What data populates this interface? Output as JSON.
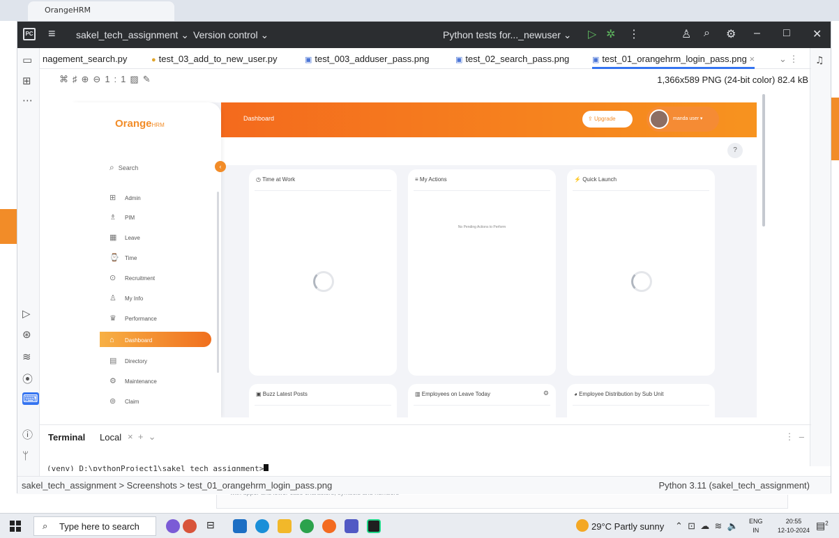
{
  "browser_tab": {
    "label": "OrangeHRM"
  },
  "titlebar": {
    "project": "sakel_tech_assignment",
    "version_control": "Version control",
    "run_config": "Python tests for..._newuser"
  },
  "editor_tabs": [
    {
      "label": "nagement_search.py"
    },
    {
      "label": "test_03_add_to_new_user.py"
    },
    {
      "label": "test_003_adduser_pass.png"
    },
    {
      "label": "test_02_search_pass.png"
    },
    {
      "label": "test_01_orangehrm_login_pass.png"
    }
  ],
  "image_info": "1,366x589 PNG (24-bit color) 82.4 kB",
  "image_zoom": "1:1",
  "orangehrm": {
    "brand": "Orange",
    "brand_suffix": "HRM",
    "search": "Search",
    "menu": [
      {
        "label": "Admin",
        "icon": "admin-icon"
      },
      {
        "label": "PIM",
        "icon": "pim-icon"
      },
      {
        "label": "Leave",
        "icon": "leave-icon"
      },
      {
        "label": "Time",
        "icon": "time-icon"
      },
      {
        "label": "Recruitment",
        "icon": "recruitment-icon"
      },
      {
        "label": "My Info",
        "icon": "my-info-icon"
      },
      {
        "label": "Performance",
        "icon": "performance-icon"
      },
      {
        "label": "Dashboard",
        "icon": "dashboard-icon"
      },
      {
        "label": "Directory",
        "icon": "directory-icon"
      },
      {
        "label": "Maintenance",
        "icon": "maintenance-icon"
      },
      {
        "label": "Claim",
        "icon": "claim-icon"
      }
    ],
    "header_title": "Dashboard",
    "upgrade": "Upgrade",
    "user": "manda user",
    "help": "?",
    "cards": [
      {
        "title": "Time at Work"
      },
      {
        "title": "My Actions",
        "empty": "No Pending Actions to Perform"
      },
      {
        "title": "Quick Launch"
      },
      {
        "title": "Buzz Latest Posts"
      },
      {
        "title": "Employees on Leave Today"
      },
      {
        "title": "Employee Distribution by Sub Unit"
      }
    ],
    "accent": "#f28c28"
  },
  "terminal": {
    "title": "Terminal",
    "tab": "Local",
    "prompt": "(venv) D:\\pythonProject1\\sakel_tech_assignment>"
  },
  "statusbar": {
    "breadcrumb": "sakel_tech_assignment  >  Screenshots  >  test_01_orangehrm_login_pass.png",
    "interpreter": "Python 3.11 (sakel_tech_assignment)"
  },
  "taskbar": {
    "search_placeholder": "Type here to search",
    "weather": "29°C  Partly sunny",
    "lang_top": "ENG",
    "lang_bottom": "IN",
    "time": "20:55",
    "date": "12-10-2024",
    "notifications": "2"
  },
  "background_text": "with upper and lower case characters, symbols and numbers"
}
